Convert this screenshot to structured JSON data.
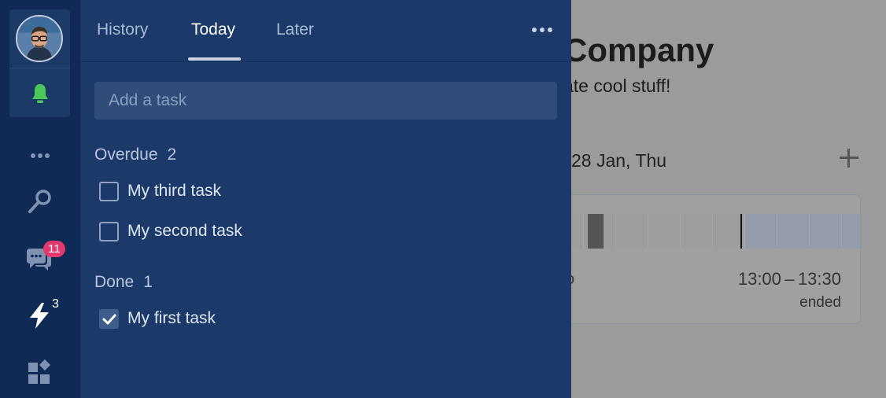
{
  "background": {
    "company_title": "Company",
    "company_subtitle": "ate cool stuff!",
    "date": "28 Jan, Thu",
    "event": {
      "partial_text": "o",
      "time": "13:00 – 13:30",
      "status": "ended"
    }
  },
  "sidebar": {
    "icons": [
      "avatar",
      "bell-icon",
      "more-icon",
      "search-icon",
      "chat-icon",
      "lightning-icon",
      "apps-icon"
    ],
    "chat_badge": "11",
    "tasks_badge": "3",
    "colors": {
      "bell": "#4cc75a",
      "badge": "#e4386f"
    }
  },
  "panel": {
    "tabs": [
      {
        "label": "History",
        "active": false
      },
      {
        "label": "Today",
        "active": true
      },
      {
        "label": "Later",
        "active": false
      }
    ],
    "add_task_placeholder": "Add a task",
    "sections": [
      {
        "title": "Overdue",
        "count": "2",
        "tasks": [
          {
            "label": "My third task",
            "done": false
          },
          {
            "label": "My second task",
            "done": false
          }
        ]
      },
      {
        "title": "Done",
        "count": "1",
        "tasks": [
          {
            "label": "My first task",
            "done": true
          }
        ]
      }
    ]
  }
}
